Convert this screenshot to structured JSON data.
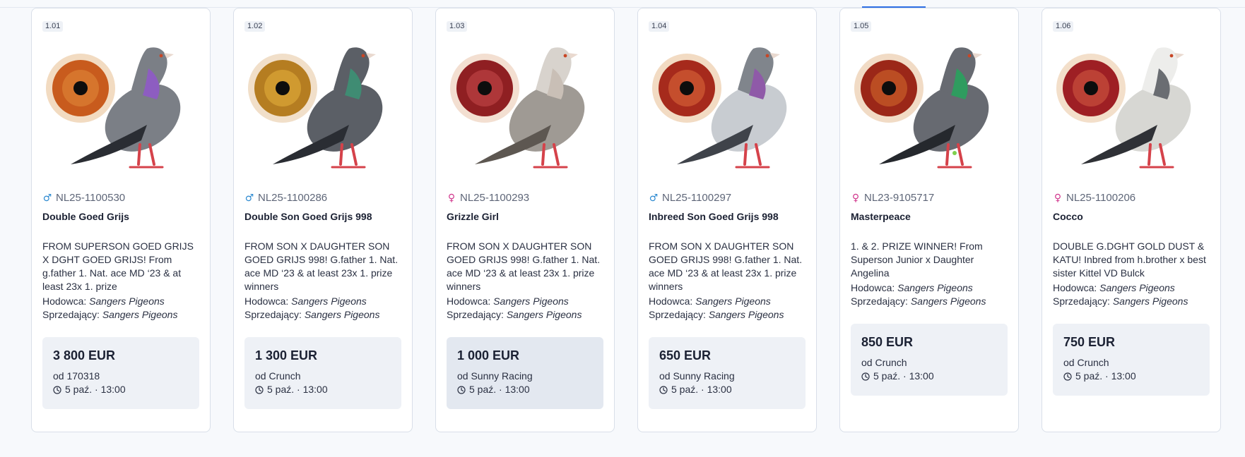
{
  "labels": {
    "breeder": "Hodowca:",
    "seller": "Sprzedający:"
  },
  "cards": [
    {
      "lot": "1.01",
      "sex": "male",
      "sex_symbol": "♂",
      "ring": "NL25-1100530",
      "name": "Double Goed Grijs",
      "description": "FROM SUPERSON GOED GRIJS X DGHT GOED GRIJS! From g.father 1. Nat. ace MD ‘23 & at least 23x 1. prize",
      "breeder": "Sangers Pigeons",
      "seller": "Sangers Pigeons",
      "price": "3 800 EUR",
      "bidder": "od 170318",
      "time": "5 paź. · 13:00",
      "eye_color": "#c85b1d",
      "pigeon_color": "#7b7f86",
      "neck_color": "#8d5dc1"
    },
    {
      "lot": "1.02",
      "sex": "male",
      "sex_symbol": "♂",
      "ring": "NL25-1100286",
      "name": "Double Son Goed Grijs 998",
      "description": "FROM SON X DAUGHTER SON GOED GRIJS 998! G.father 1. Nat. ace MD ‘23 & at least 23x 1. prize winners",
      "breeder": "Sangers Pigeons",
      "seller": "Sangers Pigeons",
      "price": "1 300 EUR",
      "bidder": "od Crunch",
      "time": "5 paź. · 13:00",
      "eye_color": "#b57d21",
      "pigeon_color": "#5b5f66",
      "neck_color": "#3f8c73"
    },
    {
      "lot": "1.03",
      "sex": "female",
      "sex_symbol": "♀",
      "ring": "NL25-1100293",
      "name": "Grizzle Girl",
      "description": "FROM SON X DAUGHTER SON GOED GRIJS 998! G.father 1. Nat. ace MD ‘23 & at least 23x 1. prize winners",
      "breeder": "Sangers Pigeons",
      "seller": "Sangers Pigeons",
      "price": "1 000 EUR",
      "bidder": "od Sunny Racing",
      "time": "5 paź. · 13:00",
      "eye_color": "#8f1f22",
      "pigeon_color": "#9f9a94",
      "neck_color": "#c9bfb6"
    },
    {
      "lot": "1.04",
      "sex": "male",
      "sex_symbol": "♂",
      "ring": "NL25-1100297",
      "name": "Inbreed Son Goed Grijs 998",
      "description": "FROM SON X DAUGHTER SON GOED GRIJS 998! G.father 1. Nat. ace MD ‘23 & at least 23x 1. prize winners",
      "breeder": "Sangers Pigeons",
      "seller": "Sangers Pigeons",
      "price": "650 EUR",
      "bidder": "od Sunny Racing",
      "time": "5 paź. · 13:00",
      "eye_color": "#a62a1c",
      "pigeon_color": "#c8ccd1",
      "neck_color": "#8f5aa8"
    },
    {
      "lot": "1.05",
      "sex": "female",
      "sex_symbol": "♀",
      "ring": "NL23-9105717",
      "name": "Masterpeace",
      "description": "1. & 2. PRIZE WINNER! From Superson Junior x Daughter Angelina",
      "breeder": "Sangers Pigeons",
      "seller": "Sangers Pigeons",
      "price": "850 EUR",
      "bidder": "od Crunch",
      "time": "5 paź. · 13:00",
      "eye_color": "#9b2718",
      "pigeon_color": "#676a71",
      "neck_color": "#2f9c5f"
    },
    {
      "lot": "1.06",
      "sex": "female",
      "sex_symbol": "♀",
      "ring": "NL25-1100206",
      "name": "Cocco",
      "description": "DOUBLE G.DGHT GOLD DUST & KATU! Inbred from h.brother x best sister Kittel VD Bulck",
      "breeder": "Sangers Pigeons",
      "seller": "Sangers Pigeons",
      "price": "750 EUR",
      "bidder": "od Crunch",
      "time": "5 paź. · 13:00",
      "eye_color": "#9e1f24",
      "pigeon_color": "#d7d7d3",
      "neck_color": "#6a6d72"
    }
  ]
}
